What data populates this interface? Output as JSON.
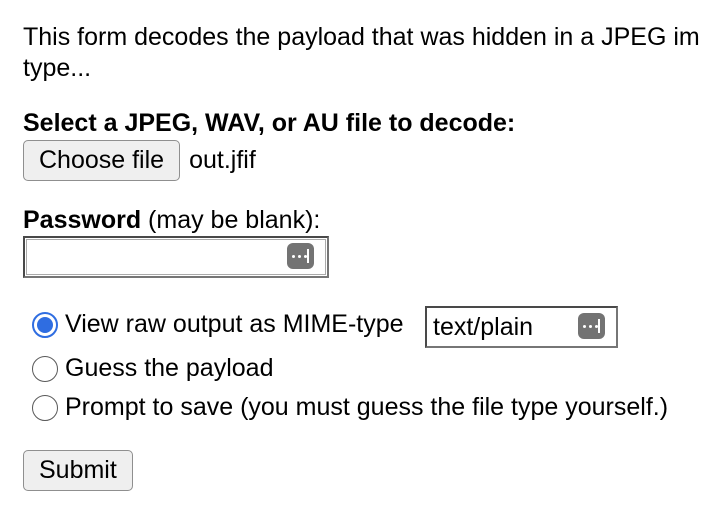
{
  "intro": {
    "line1": "This form decodes the payload that was hidden in a JPEG im",
    "line2": "type..."
  },
  "file_section": {
    "label": "Select a JPEG, WAV, or AU file to decode:",
    "choose_button": "Choose file",
    "file_name": "out.jfif"
  },
  "password_section": {
    "label_bold": "Password",
    "label_rest": " (may be blank):",
    "value": ""
  },
  "options": {
    "raw_label": "View raw output as MIME-type",
    "raw_checked": true,
    "mime_value": "text/plain",
    "guess_label": "Guess the payload",
    "prompt_label": "Prompt to save (you must guess the file type yourself.)"
  },
  "submit_label": "Submit",
  "icons": {
    "password_manager": "password-manager-key-icon"
  },
  "colors": {
    "radio_accent": "#2f6de1",
    "key_icon_bg": "#737373",
    "button_bg": "#efefef"
  }
}
